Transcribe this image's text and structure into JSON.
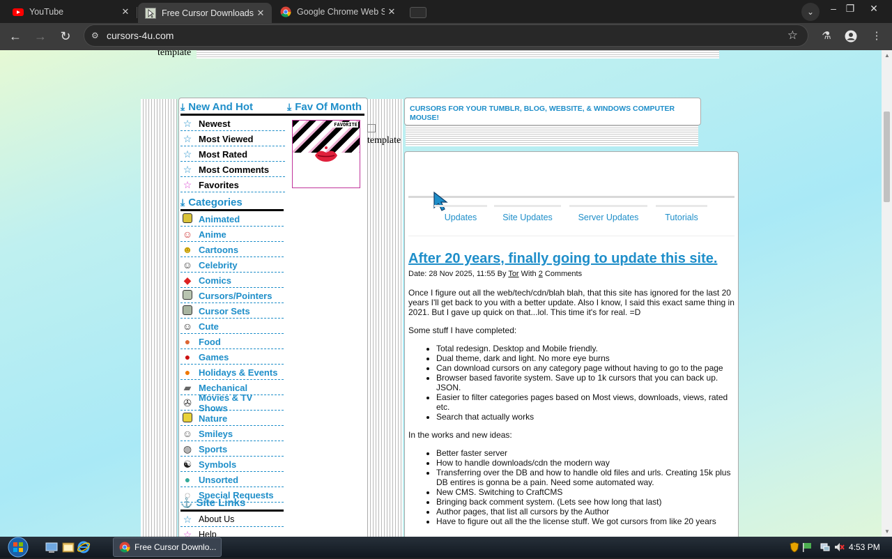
{
  "browser": {
    "tabs": [
      {
        "title": "YouTube",
        "active": false
      },
      {
        "title": "Free Cursor Downloads",
        "active": true
      },
      {
        "title": "Google Chrome Web Store",
        "active": false
      }
    ],
    "url": "cursors-4u.com"
  },
  "page": {
    "broken_images": [
      "template",
      "template"
    ],
    "nav": {
      "new_hot_title": "New And Hot",
      "fav_title": "Fav Of Month",
      "fav_badge": "FAVORITE",
      "new_items": [
        "Newest",
        "Most Viewed",
        "Most Rated",
        "Most Comments",
        "Favorites"
      ],
      "categories_title": "Categories",
      "categories": [
        "Animated",
        "Anime",
        "Cartoons",
        "Celebrity",
        "Comics",
        "Cursors/Pointers",
        "Cursor Sets",
        "Cute",
        "Food",
        "Games",
        "Holidays & Events",
        "Mechanical",
        "Movies & TV Shows",
        "Nature",
        "Smileys",
        "Sports",
        "Symbols",
        "Unsorted",
        "Special Requests"
      ],
      "site_links_title": "Site Links",
      "site_links": [
        "About Us",
        "Help"
      ]
    },
    "tagline": "CURSORS FOR YOUR TUMBLR, BLOG, WEBSITE, & WINDOWS COMPUTER MOUSE!",
    "subtabs": [
      "Updates",
      "Site Updates",
      "Server Updates",
      "Tutorials"
    ],
    "post": {
      "title": "After 20 years, finally going to update this site.",
      "meta_prefix": "Date: 28 Nov 2025, 11:55 By ",
      "author": "Tor",
      "meta_with": " With ",
      "comments_count": "2",
      "comments_label": " Comments",
      "intro": "Once I figure out all the web/tech/cdn/blah blah, that this site has ignored for the last 20 years I'll get back to you with a better update. Also I know, I said this exact same thing in 2021. But I gave up quick on that...lol. This time it's for real. =D",
      "completed_heading": "Some stuff I have completed:",
      "completed": [
        "Total redesign. Desktop and Mobile friendly.",
        "Dual theme, dark and light. No more eye burns",
        "Can download cursors on any category page without having to go to the page",
        "Browser based favorite system. Save up to 1k cursors that you can back up. JSON.",
        "Easier to filter categories pages based on Most views, downloads, views, rated etc.",
        "Search that actually works"
      ],
      "works_heading": "In the works and new ideas:",
      "works": [
        "Better faster server",
        "How to handle downloads/cdn the modern way",
        "Transferring over the DB and how to handle old files and urls. Creating 15k plus DB entires is gonna be a pain. Need some automated way.",
        "New CMS. Switching to CraftCMS",
        "Bringing back comment system. (Lets see how long that last)",
        "Author pages, that list all cursors by the Author",
        "Have to figure out all the the license stuff. We got cursors from like 20 years"
      ]
    }
  },
  "taskbar": {
    "task_title": "Free Cursor Downlo...",
    "clock": "4:53 PM"
  }
}
